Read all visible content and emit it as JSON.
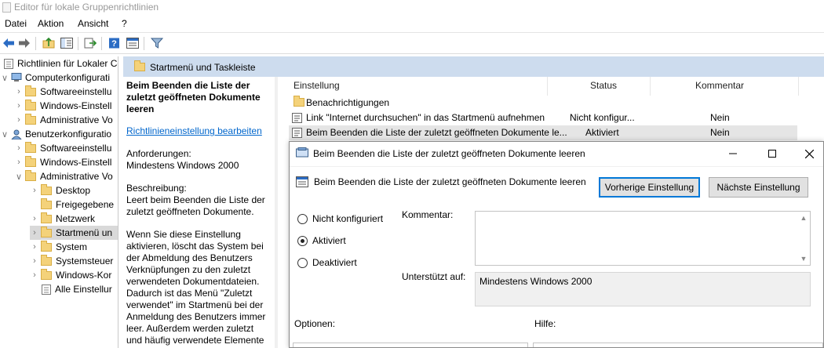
{
  "window": {
    "title": "Editor für lokale Gruppenrichtlinien"
  },
  "menu": [
    "Datei",
    "Aktion",
    "Ansicht",
    "?"
  ],
  "toolbar_icons": [
    "back-arrow-icon",
    "forward-arrow-icon",
    "up-folder-icon",
    "show-hide-tree-icon",
    "export-list-icon",
    "help-icon",
    "properties-icon",
    "filter-icon"
  ],
  "tree": {
    "root": "Richtlinien für Lokaler Co",
    "items": [
      {
        "label": "Computerkonfigurati",
        "level": 1,
        "expanded": true,
        "icon": "computer"
      },
      {
        "label": "Softwareeinstellu",
        "level": 2,
        "expanded": false,
        "icon": "folder"
      },
      {
        "label": "Windows-Einstell",
        "level": 2,
        "expanded": false,
        "icon": "folder"
      },
      {
        "label": "Administrative Vo",
        "level": 2,
        "expanded": false,
        "icon": "folder"
      },
      {
        "label": "Benutzerkonfiguratio",
        "level": 1,
        "expanded": true,
        "icon": "user"
      },
      {
        "label": "Softwareeinstellu",
        "level": 2,
        "expanded": false,
        "icon": "folder"
      },
      {
        "label": "Windows-Einstell",
        "level": 2,
        "expanded": false,
        "icon": "folder"
      },
      {
        "label": "Administrative Vo",
        "level": 2,
        "expanded": true,
        "icon": "folder"
      },
      {
        "label": "Desktop",
        "level": 3,
        "expanded": false,
        "icon": "folder"
      },
      {
        "label": "Freigegebene",
        "level": 3,
        "expanded": null,
        "icon": "folder"
      },
      {
        "label": "Netzwerk",
        "level": 3,
        "expanded": false,
        "icon": "folder"
      },
      {
        "label": "Startmenü un",
        "level": 3,
        "expanded": false,
        "icon": "folder",
        "selected": true
      },
      {
        "label": "System",
        "level": 3,
        "expanded": false,
        "icon": "folder"
      },
      {
        "label": "Systemsteuer",
        "level": 3,
        "expanded": false,
        "icon": "folder"
      },
      {
        "label": "Windows-Kor",
        "level": 3,
        "expanded": false,
        "icon": "folder"
      },
      {
        "label": "Alle Einstellur",
        "level": 3,
        "expanded": null,
        "icon": "settings"
      }
    ]
  },
  "section_title": "Startmenü und Taskleiste",
  "description": {
    "title": "Beim Beenden die Liste der zuletzt geöffneten Dokumente leeren",
    "edit_link": "Richtlinieneinstellung bearbeiten",
    "requirements_label": "Anforderungen:",
    "requirements_value": "Mindestens Windows 2000",
    "description_label": "Beschreibung:",
    "description_text": "Leert beim Beenden die Liste der zuletzt geöffneten Dokumente.",
    "details": "Wenn Sie diese Einstellung aktivieren, löscht das System bei der Abmeldung des Benutzers Verknüpfungen zu den zuletzt verwendeten Dokumentdateien. Dadurch ist das Menü \"Zuletzt verwendet\" im Startmenü bei der Anmeldung des Benutzers immer leer. Außerdem werden zuletzt und häufig verwendete Elemente aus programmspezifischen"
  },
  "list": {
    "columns": {
      "setting": "Einstellung",
      "status": "Status",
      "comment": "Kommentar"
    },
    "rows": [
      {
        "name": "Benachrichtigungen",
        "status": "",
        "comment": "",
        "type": "folder"
      },
      {
        "name": "Link \"Internet durchsuchen\" in das Startmenü aufnehmen",
        "status": "Nicht konfigur...",
        "comment": "Nein",
        "type": "policy"
      },
      {
        "name": "Beim Beenden die Liste der zuletzt geöffneten Dokumente le...",
        "status": "Aktiviert",
        "comment": "Nein",
        "type": "policy",
        "selected": true
      }
    ]
  },
  "dialog": {
    "title": "Beim Beenden die Liste der zuletzt geöffneten Dokumente leeren",
    "setting_name": "Beim Beenden die Liste der zuletzt geöffneten Dokumente leeren",
    "prev_button": "Vorherige Einstellung",
    "next_button": "Nächste Einstellung",
    "options": [
      "Nicht konfiguriert",
      "Aktiviert",
      "Deaktiviert"
    ],
    "selected_option": "Aktiviert",
    "comment_label": "Kommentar:",
    "comment_value": "",
    "supported_label": "Unterstützt auf:",
    "supported_value": "Mindestens Windows 2000",
    "options_label": "Optionen:",
    "help_label": "Hilfe:",
    "minimize_icon": "minimize-icon",
    "maximize_icon": "maximize-icon",
    "close_icon": "close-icon"
  }
}
